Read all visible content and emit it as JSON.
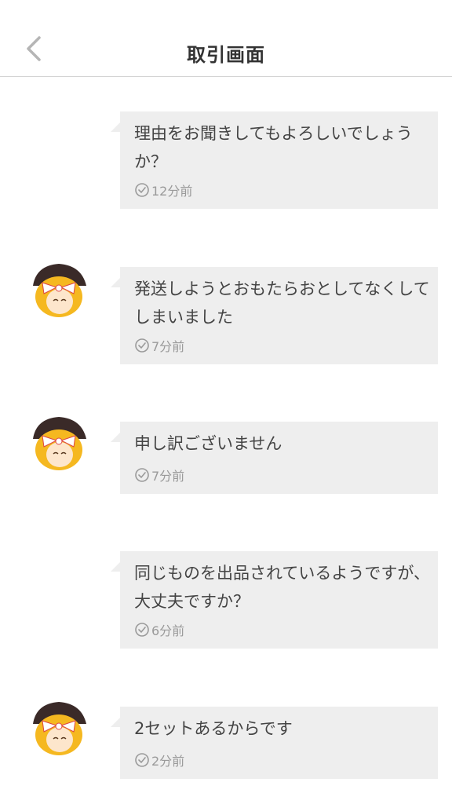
{
  "header": {
    "title": "取引画面",
    "back_icon": "chevron-left-icon"
  },
  "messages": [
    {
      "sender": "other",
      "text": "理由をお聞きしてもよろしいでしょうか？",
      "time": "12分前"
    },
    {
      "sender": "self",
      "text": "発送しようとおもたらおとしてなくしてしまいました",
      "time": "7分前"
    },
    {
      "sender": "self",
      "text": "申し訳ございません",
      "time": "7分前"
    },
    {
      "sender": "other",
      "text": "同じものを出品されているようですが、大丈夫ですか？",
      "time": "6分前"
    },
    {
      "sender": "self",
      "text": "2セットあるからです",
      "time": "2分前"
    }
  ],
  "colors": {
    "bubble": "#eeeeee",
    "text": "#444444",
    "time": "#9a9a9a",
    "header_border": "#d4d4d4"
  }
}
